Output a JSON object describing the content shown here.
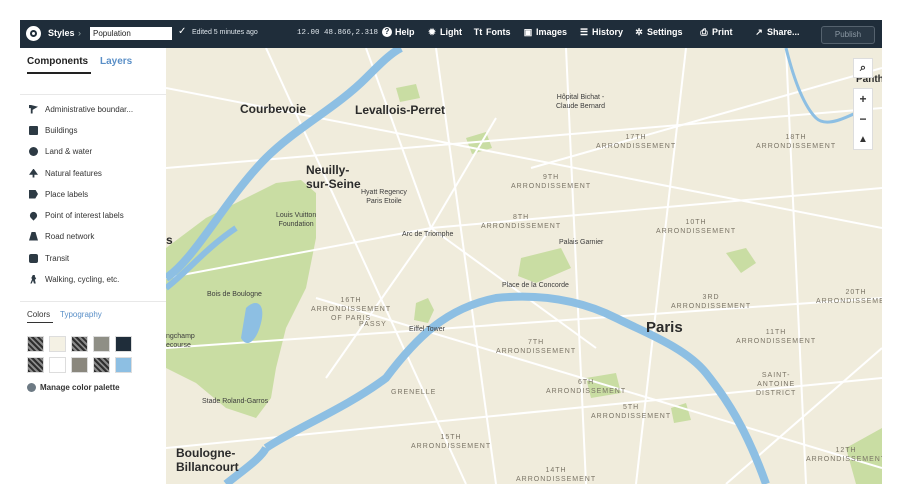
{
  "toolbar": {
    "styles_label": "Styles",
    "breadcrumb_separator": "›",
    "style_name": "Population",
    "edited_text": "Edited 5 minutes ago",
    "coordinates": "12.00 48.866,2.318",
    "help_label": "Help",
    "light_label": "Light",
    "fonts_label": "Fonts",
    "images_label": "Images",
    "history_label": "History",
    "settings_label": "Settings",
    "print_label": "Print",
    "share_label": "Share...",
    "publish_label": "Publish"
  },
  "sidebar": {
    "tabs": {
      "components": "Components",
      "layers": "Layers"
    },
    "components": [
      {
        "label": "Administrative boundar...",
        "icon": "flag-icon"
      },
      {
        "label": "Buildings",
        "icon": "building-icon"
      },
      {
        "label": "Land & water",
        "icon": "globe-icon"
      },
      {
        "label": "Natural features",
        "icon": "tree-icon"
      },
      {
        "label": "Place labels",
        "icon": "tag-icon"
      },
      {
        "label": "Point of interest labels",
        "icon": "pin-icon"
      },
      {
        "label": "Road network",
        "icon": "road-icon"
      },
      {
        "label": "Transit",
        "icon": "bus-icon"
      },
      {
        "label": "Walking, cycling, etc.",
        "icon": "walk-icon"
      }
    ],
    "subtabs": {
      "colors": "Colors",
      "typography": "Typography"
    },
    "swatches": [
      {
        "color": "#2e2e2e",
        "pattern": "hatch"
      },
      {
        "color": "#f4f1e4",
        "pattern": "solid"
      },
      {
        "color": "#4a4a4a",
        "pattern": "hatch"
      },
      {
        "color": "#8f8f86",
        "pattern": "solid"
      },
      {
        "color": "#1f2d3a",
        "pattern": "solid"
      },
      {
        "color": "#4a4a4a",
        "pattern": "hatch"
      },
      {
        "color": "#ffffff",
        "pattern": "solid"
      },
      {
        "color": "#8a877d",
        "pattern": "solid"
      },
      {
        "color": "#3a3a3a",
        "pattern": "hatch"
      },
      {
        "color": "#8dbfe3",
        "pattern": "solid"
      }
    ],
    "manage_palette": "Manage color palette"
  },
  "map": {
    "colors": {
      "land": "#f0ecdc",
      "park": "#c9dda3",
      "water": "#8dbfe3",
      "road": "#ffffff",
      "road_major": "#f8f5ea"
    },
    "labels": {
      "courbevoie": "Courbevoie",
      "levallois": "Levallois-Perret",
      "neuilly": "Neuilly-\nsur-Seine",
      "hopital": "Hôpital Bichat -\nClaude Bernard",
      "arr17": "17TH\nARRONDISSEMENT",
      "arr18": "18TH\nARRONDISSEMENT",
      "arr8": "8TH\nARRONDISSEMENT",
      "arr9": "9TH\nARRONDISSEMENT",
      "arr10": "10TH\nARRONDISSEMENT",
      "arr3": "3RD\nARRONDISSEMENT",
      "arr20": "20TH\nARRONDISSEMENT",
      "arr11": "11TH\nARRONDISSEMENT",
      "arr16": "16TH\nARRONDISSEMENT\nOF PARIS",
      "arr7": "7TH\nARRONDISSEMENT",
      "arr6": "6TH\nARRONDISSEMENT",
      "arr5": "5TH\nARRONDISSEMENT",
      "arr15": "15TH\nARRONDISSEMENT",
      "arr14": "14TH\nARRONDISSEMENT",
      "arr12": "12TH\nARRONDISSEMENT",
      "hyatt": "Hyatt Regency\nParis Etoile",
      "vuitton": "Louis Vuitton\nFoundation",
      "arc": "Arc de Triomphe",
      "garnier": "Palais Garnier",
      "concorde": "Place de la Concorde",
      "eiffel": "Eiffel Tower",
      "paris": "Paris",
      "passy": "PASSY",
      "grenelle": "GRENELLE",
      "bois": "Bois de Boulogne",
      "longchamp": "ngchamp\necourse",
      "roland": "Stade Roland-Garros",
      "boulogne": "Boulogne-\nBillancourt",
      "saint_antoine": "SAINT-\nANTOINE\nDISTRICT",
      "panth": "Panth",
      "left_s": "s"
    }
  }
}
